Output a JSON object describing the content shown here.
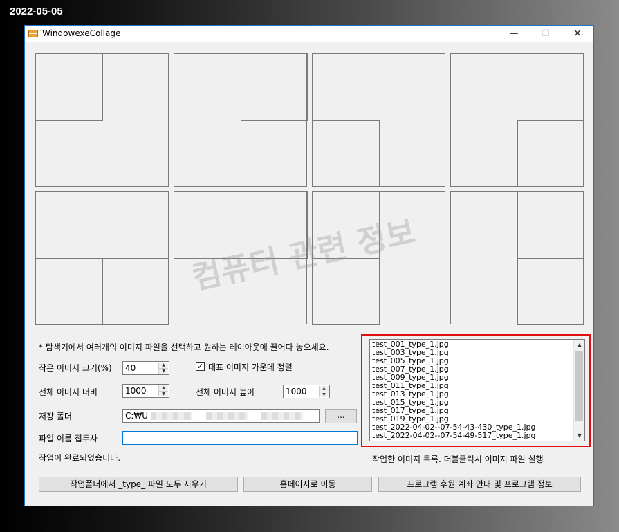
{
  "date_label": "2022-05-05",
  "window": {
    "title": "WindowexeCollage",
    "min_glyph": "—",
    "max_glyph": "☐",
    "close_glyph": "✕"
  },
  "watermark": "컴퓨터 관련 정보",
  "instructions": "* 탐색기에서 여러개의 이미지 파일을 선택하고 원하는 레이아웃에 끌어다 놓으세요.",
  "small_image_size": {
    "label": "작은 이미지 크기(%)",
    "value": "40"
  },
  "center_align": {
    "label": "대표 이미지 가운데 정렬",
    "checked": true,
    "check_glyph": "✓"
  },
  "total_width": {
    "label": "전체 이미지 너비",
    "value": "1000"
  },
  "total_height": {
    "label": "전체 이미지 높이",
    "value": "1000"
  },
  "save_folder": {
    "label": "저장 폴더",
    "value": "C:₩U",
    "browse_label": "..."
  },
  "file_prefix": {
    "label": "파일 이름 접두사",
    "value": ""
  },
  "status_text": "작업이 완료되었습니다.",
  "file_list": {
    "items": [
      "test_001_type_1.jpg",
      "test_003_type_1.jpg",
      "test_005_type_1.jpg",
      "test_007_type_1.jpg",
      "test_009_type_1.jpg",
      "test_011_type_1.jpg",
      "test_013_type_1.jpg",
      "test_015_type_1.jpg",
      "test_017_type_1.jpg",
      "test_019_type_1.jpg",
      "test_2022-04-02--07-54-43-430_type_1.jpg",
      "test_2022-04-02--07-54-49-517_type_1.jpg"
    ],
    "caption": "작업한 이미지 목록. 더블클릭시 이미지 파일 실행"
  },
  "buttons": {
    "delete_type_files": "작업폴더에서 _type_ 파일 모두 지우기",
    "homepage": "홈페이지로 이동",
    "donation_info": "프로그램 후원 계좌 안내 및 프로그램 정보"
  },
  "layouts": [
    {
      "name": "layout-1"
    },
    {
      "name": "layout-2"
    },
    {
      "name": "layout-3"
    },
    {
      "name": "layout-4"
    },
    {
      "name": "layout-5"
    },
    {
      "name": "layout-6"
    },
    {
      "name": "layout-7"
    },
    {
      "name": "layout-8"
    }
  ]
}
